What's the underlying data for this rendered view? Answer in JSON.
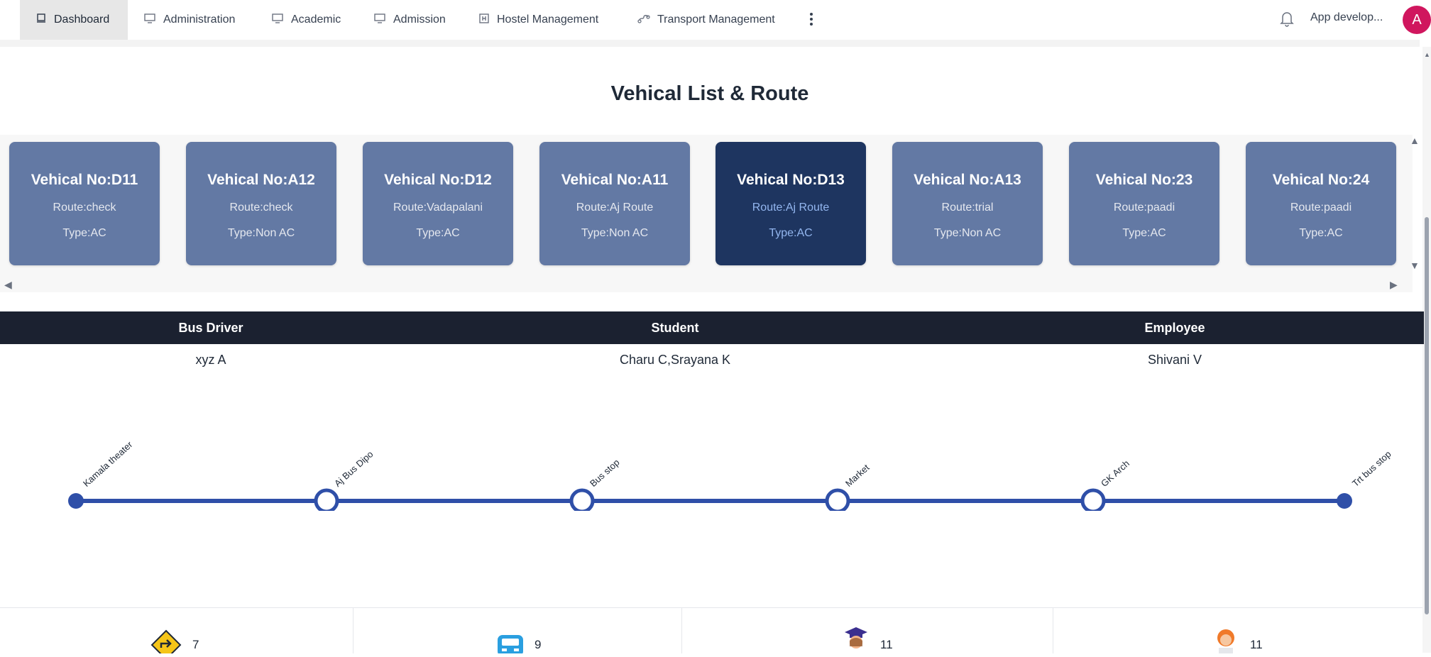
{
  "nav": {
    "items": [
      {
        "label": "Dashboard",
        "icon": "dashboard-icon"
      },
      {
        "label": "Administration",
        "icon": "monitor-icon"
      },
      {
        "label": "Academic",
        "icon": "monitor-icon"
      },
      {
        "label": "Admission",
        "icon": "monitor-icon"
      },
      {
        "label": "Hostel Management",
        "icon": "hostel-icon"
      },
      {
        "label": "Transport Management",
        "icon": "transport-icon"
      }
    ],
    "app_name": "App develop...",
    "avatar_letter": "A",
    "avatar_color": "#d0165e"
  },
  "page_title": "Vehical List & Route",
  "vehicles": [
    {
      "no": "Vehical No:D11",
      "route": "Route:check",
      "type": "Type:AC"
    },
    {
      "no": "Vehical No:A12",
      "route": "Route:check",
      "type": "Type:Non AC"
    },
    {
      "no": "Vehical No:D12",
      "route": "Route:Vadapalani",
      "type": "Type:AC"
    },
    {
      "no": "Vehical No:A11",
      "route": "Route:Aj Route",
      "type": "Type:Non AC"
    },
    {
      "no": "Vehical No:D13",
      "route": "Route:Aj Route",
      "type": "Type:AC"
    },
    {
      "no": "Vehical No:A13",
      "route": "Route:trial",
      "type": "Type:Non AC"
    },
    {
      "no": "Vehical No:23",
      "route": "Route:paadi",
      "type": "Type:AC"
    },
    {
      "no": "Vehical No:24",
      "route": "Route:paadi",
      "type": "Type:AC"
    }
  ],
  "selected_vehicle": "Vehical No:D13",
  "colors": {
    "card": "#6379a4",
    "card_active": "#1e3560",
    "table_header": "#1b2130",
    "route_line": "#2f4fa8"
  },
  "table": {
    "headers": [
      "Bus Driver",
      "Student",
      "Employee"
    ],
    "row": [
      "xyz A",
      "Charu C,Srayana K",
      "Shivani V"
    ]
  },
  "route_stops": [
    "Kamala theater",
    "Aj Bus Dipo",
    "Bus stop",
    "Market",
    "GK Arch",
    "Trt bus stop"
  ],
  "stats": [
    {
      "icon": "route-sign-icon",
      "value": "7"
    },
    {
      "icon": "bus-icon",
      "value": "9"
    },
    {
      "icon": "student-icon",
      "value": "11"
    },
    {
      "icon": "employee-icon",
      "value": "11"
    }
  ]
}
